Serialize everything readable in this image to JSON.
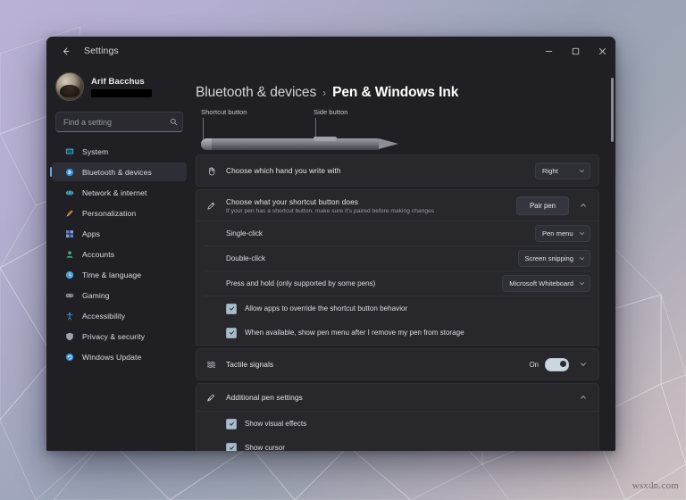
{
  "desktop": {
    "watermark": "wsxdn.com"
  },
  "window": {
    "back_icon": "back-arrow-icon",
    "title": "Settings",
    "controls": {
      "minimize": "minimize-icon",
      "maximize": "maximize-icon",
      "close": "close-icon"
    }
  },
  "sidebar": {
    "account": {
      "name": "Arif Bacchus",
      "email_redacted": true,
      "avatar": "user-avatar"
    },
    "search": {
      "placeholder": "Find a setting",
      "value": "",
      "icon": "search-icon"
    },
    "items": [
      {
        "label": "System",
        "icon": "system-icon",
        "color": "#35c3e8",
        "selected": false
      },
      {
        "label": "Bluetooth & devices",
        "icon": "bluetooth-icon",
        "color": "#2f8fe0",
        "selected": true
      },
      {
        "label": "Network & internet",
        "icon": "network-icon",
        "color": "#3aa6c4",
        "selected": false
      },
      {
        "label": "Personalization",
        "icon": "personalization-icon",
        "color": "#c98a3a",
        "selected": false
      },
      {
        "label": "Apps",
        "icon": "apps-icon",
        "color": "#5a7fd6",
        "selected": false
      },
      {
        "label": "Accounts",
        "icon": "accounts-icon",
        "color": "#3eb489",
        "selected": false
      },
      {
        "label": "Time & language",
        "icon": "clock-icon",
        "color": "#4a9fd8",
        "selected": false
      },
      {
        "label": "Gaming",
        "icon": "gaming-icon",
        "color": "#8a8a96",
        "selected": false
      },
      {
        "label": "Accessibility",
        "icon": "accessibility-icon",
        "color": "#3f8fd0",
        "selected": false
      },
      {
        "label": "Privacy & security",
        "icon": "shield-icon",
        "color": "#9aa3ae",
        "selected": false
      },
      {
        "label": "Windows Update",
        "icon": "update-icon",
        "color": "#2f8fe0",
        "selected": false
      }
    ]
  },
  "main": {
    "breadcrumb": {
      "parent": "Bluetooth & devices",
      "separator": "›",
      "current": "Pen & Windows Ink"
    },
    "pen_illustration": {
      "callout_shortcut": "Shortcut button",
      "callout_side": "Side button"
    },
    "hand_row": {
      "icon": "hand-icon",
      "title": "Choose which hand you write with",
      "dropdown_value": "Right",
      "chevron": "chevron-down-icon"
    },
    "shortcut_row": {
      "icon": "pen-icon",
      "title": "Choose what your shortcut button does",
      "subtitle": "If your pen has a shortcut button, make sure it's paired before making changes",
      "button_label": "Pair pen",
      "expander": "chevron-up-icon"
    },
    "shortcut_options": [
      {
        "label": "Single-click",
        "value": "Pen menu",
        "chevron": "chevron-down-icon"
      },
      {
        "label": "Double-click",
        "value": "Screen snipping",
        "chevron": "chevron-down-icon"
      },
      {
        "label": "Press and hold (only supported by some pens)",
        "value": "Microsoft Whiteboard",
        "chevron": "chevron-down-icon"
      }
    ],
    "shortcut_checkboxes": [
      {
        "label": "Allow apps to override the shortcut button behavior",
        "checked": true
      },
      {
        "label": "When available, show pen menu after I remove my pen from storage",
        "checked": true
      }
    ],
    "tactile_row": {
      "icon": "tactile-icon",
      "title": "Tactile signals",
      "toggle_state": "On",
      "toggle_on": true,
      "expander": "chevron-down-icon"
    },
    "additional_row": {
      "icon": "pen-settings-icon",
      "title": "Additional pen settings",
      "expander": "chevron-up-icon"
    },
    "additional_checkboxes": [
      {
        "label": "Show visual effects",
        "checked": true
      },
      {
        "label": "Show cursor",
        "checked": true
      }
    ],
    "scrollbar": "vertical-scrollbar"
  }
}
